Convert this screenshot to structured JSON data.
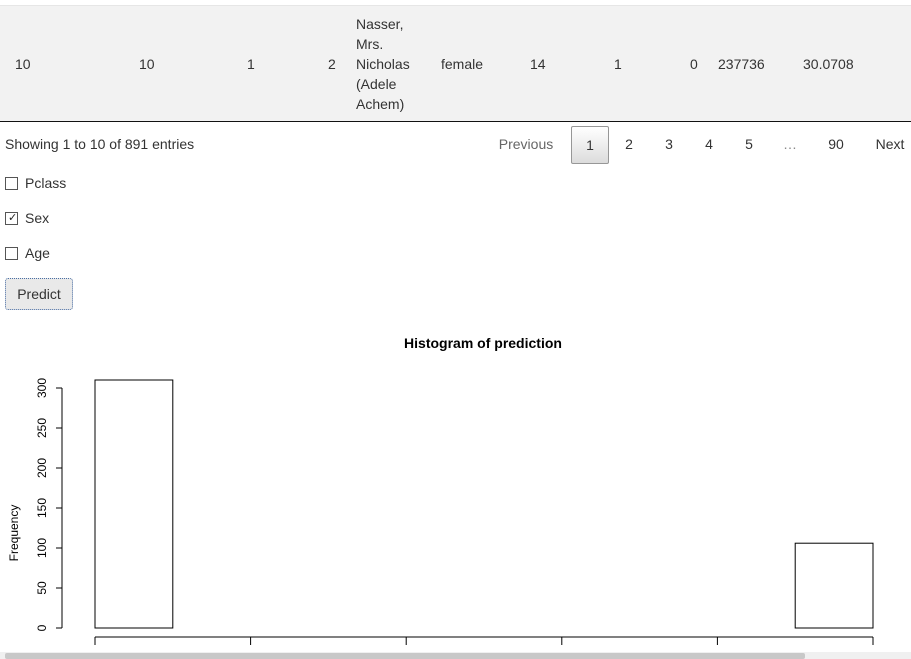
{
  "table": {
    "row": {
      "c1": "10",
      "c2": "10",
      "c3": "1",
      "c4": "2",
      "name_lines": [
        "Nasser,",
        "Mrs.",
        "Nicholas",
        "(Adele",
        "Achem)"
      ],
      "sex": "female",
      "age": "14",
      "sibsp": "1",
      "parch": "0",
      "ticket": "237736",
      "fare": "30.0708"
    },
    "info": "Showing 1 to 10 of 891 entries",
    "pagination": {
      "previous": "Previous",
      "pages": [
        "1",
        "2",
        "3",
        "4",
        "5"
      ],
      "ellipsis": "…",
      "last": "90",
      "next": "Next",
      "current": "1"
    }
  },
  "controls": {
    "checkboxes": [
      {
        "label": "Pclass",
        "checked": false
      },
      {
        "label": "Sex",
        "checked": true
      },
      {
        "label": "Age",
        "checked": false
      }
    ],
    "predict_label": "Predict"
  },
  "chart_data": {
    "type": "bar",
    "title": "Histogram of prediction",
    "xlabel": "",
    "ylabel": "Frequency",
    "y_ticks": [
      "0",
      "50",
      "100",
      "150",
      "200",
      "250",
      "300"
    ],
    "ylim": [
      0,
      310
    ],
    "bins": 10,
    "values": [
      310,
      0,
      0,
      0,
      0,
      0,
      0,
      0,
      0,
      106
    ]
  }
}
